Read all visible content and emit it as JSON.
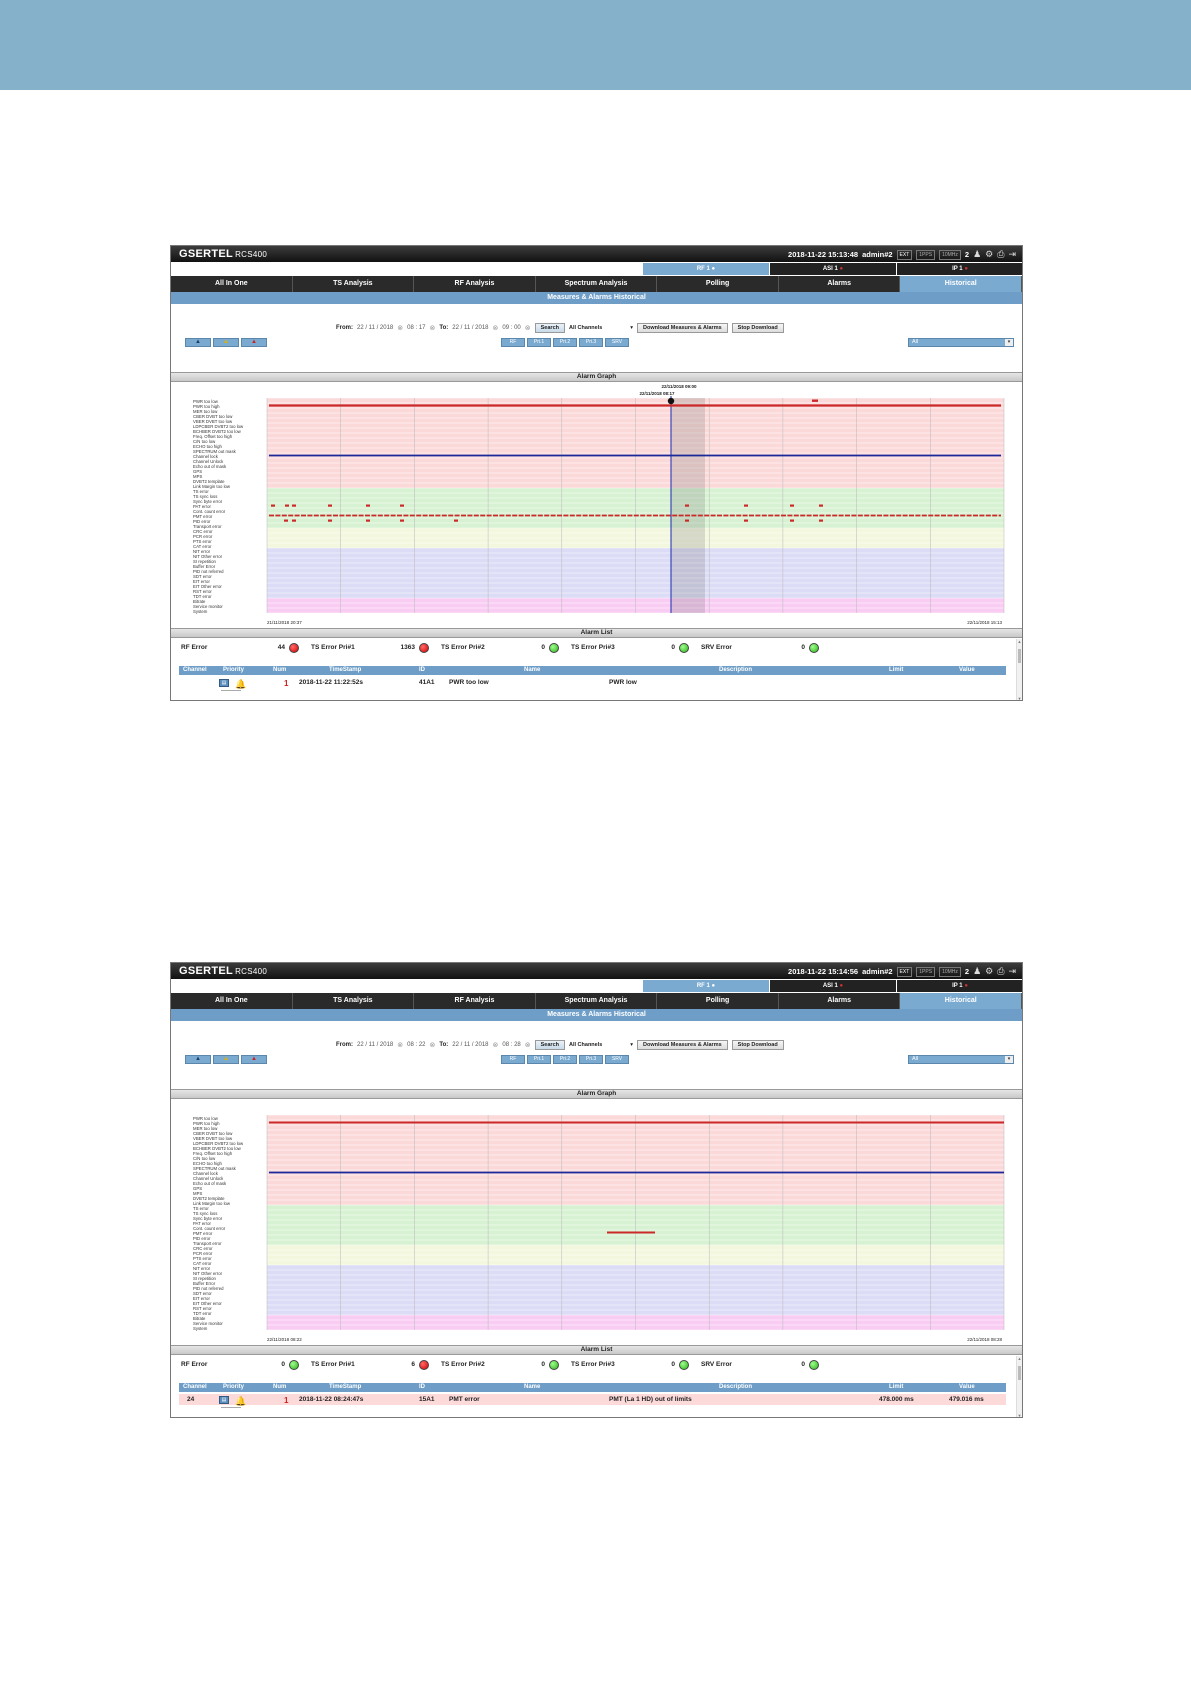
{
  "app": {
    "brand": "GSERTEL",
    "model": "RCS400"
  },
  "colors": {
    "top_band": "#85b1cb",
    "nav_active": "#7aaad0",
    "title_bar": "#6e9ec7",
    "led_red": "#d40000",
    "led_green": "#2fb21a",
    "alarm_red": "#cc2a2a",
    "alarm_blue": "#1a2a9a"
  },
  "header_icons": [
    "users-icon",
    "gear-icon",
    "print-icon",
    "logout-icon"
  ],
  "inputs": [
    {
      "label": "RF 1",
      "active": true
    },
    {
      "label": "ASI 1",
      "active": false
    },
    {
      "label": "IP 1",
      "active": false
    }
  ],
  "nav": [
    "All In One",
    "TS Analysis",
    "RF Analysis",
    "Spectrum Analysis",
    "Polling",
    "Alarms",
    "Historical"
  ],
  "active_nav": "Historical",
  "page_title": "Measures & Alarms Historical",
  "filters": {
    "from_label": "From:",
    "to_label": "To:",
    "search_label": "Search",
    "channels_label": "All Channels",
    "download_label": "Download Measures & Alarms",
    "stop_label": "Stop Download"
  },
  "ack_buttons": [
    "ack-blue-icon",
    "ack-yellow-icon",
    "ack-red-icon"
  ],
  "filter_buttons": [
    "RF",
    "Pri.1",
    "Pri.2",
    "Pri.3",
    "SRV"
  ],
  "filter_all": "All",
  "graph_title": "Alarm Graph",
  "list_title": "Alarm List",
  "alarm_types": [
    "PWR too low",
    "PWR too high",
    "MER too low",
    "CBER DVBT too low",
    "VBER DVBT too low",
    "LDPCBER DVBT2 too low",
    "BCHBER DVBT2 too low",
    "Freq. Offset too high",
    "C/N too low",
    "ECHO too high",
    "SPECTRUM out mask",
    "Channel lock",
    "Channel Unlock",
    "Echo out of mask",
    "GPS",
    "MPS",
    "DVBT2 template",
    "Link Margin too low",
    "TS error",
    "TS sync loss",
    "Sync byte error",
    "PAT error",
    "Cont. count error",
    "PMT error",
    "PID error",
    "Transport error",
    "CRC error",
    "PCR error",
    "PTS error",
    "CAT error",
    "NIT error",
    "NIT Other error",
    "SI repetition",
    "Buffer Error",
    "PID not referred",
    "SDT error",
    "EIT error",
    "EIT Other error",
    "RST error",
    "TDT error",
    "Bitrate",
    "Service monitor",
    "System"
  ],
  "summary_labels": [
    "RF Error",
    "TS Error Pri#1",
    "TS Error Pri#2",
    "TS Error Pri#3",
    "SRV Error"
  ],
  "table_headers": [
    "Channel",
    "Priority",
    "Num",
    "TimeStamp",
    "ID",
    "Name",
    "Description",
    "Limit",
    "Value"
  ],
  "screens": [
    {
      "header": {
        "datetime": "2018-11-22 15:13:48",
        "user": "admin#2",
        "indicators": [
          "EXT",
          "1PPS",
          "10MHz"
        ],
        "users_count": "2"
      },
      "filters": {
        "from_date": "22 / 11 / 2018",
        "from_time": "08 : 17",
        "to_date": "22 / 11 / 2018",
        "to_time": "09 : 00"
      },
      "graph": {
        "date_start": "21/11/2018 20:37",
        "date_end": "22/11/2018 15:13",
        "cursor_label": "22/11/2018 09:00",
        "cursor_sub": "22/11/2018 08:17"
      },
      "summary": [
        {
          "value": "44",
          "status": "red"
        },
        {
          "value": "1363",
          "status": "red"
        },
        {
          "value": "0",
          "status": "green"
        },
        {
          "value": "0",
          "status": "green"
        },
        {
          "value": "0",
          "status": "green"
        }
      ],
      "row": {
        "channel": "",
        "num": "1",
        "timestamp": "2018-11-22 11:22:52s",
        "id": "41A1",
        "name": "PWR too low",
        "description": "PWR low",
        "limit": "",
        "value": "",
        "highlight": false
      }
    },
    {
      "header": {
        "datetime": "2018-11-22 15:14:56",
        "user": "admin#2",
        "indicators": [
          "EXT",
          "1PPS",
          "10MHz"
        ],
        "users_count": "2"
      },
      "filters": {
        "from_date": "22 / 11 / 2018",
        "from_time": "08 : 22",
        "to_date": "22 / 11 / 2018",
        "to_time": "08 : 28"
      },
      "graph": {
        "date_start": "22/11/2018 08:22",
        "date_end": "22/11/2018 08:28",
        "cursor_label": "",
        "cursor_sub": ""
      },
      "summary": [
        {
          "value": "0",
          "status": "green"
        },
        {
          "value": "6",
          "status": "red"
        },
        {
          "value": "0",
          "status": "green"
        },
        {
          "value": "0",
          "status": "green"
        },
        {
          "value": "0",
          "status": "green"
        }
      ],
      "row": {
        "channel": "24",
        "num": "1",
        "timestamp": "2018-11-22 08:24:47s",
        "id": "15A1",
        "name": "PMT error",
        "description": "PMT (La 1 HD) out of limits",
        "limit": "478.000 ms",
        "value": "479.016 ms",
        "highlight": true
      }
    }
  ]
}
